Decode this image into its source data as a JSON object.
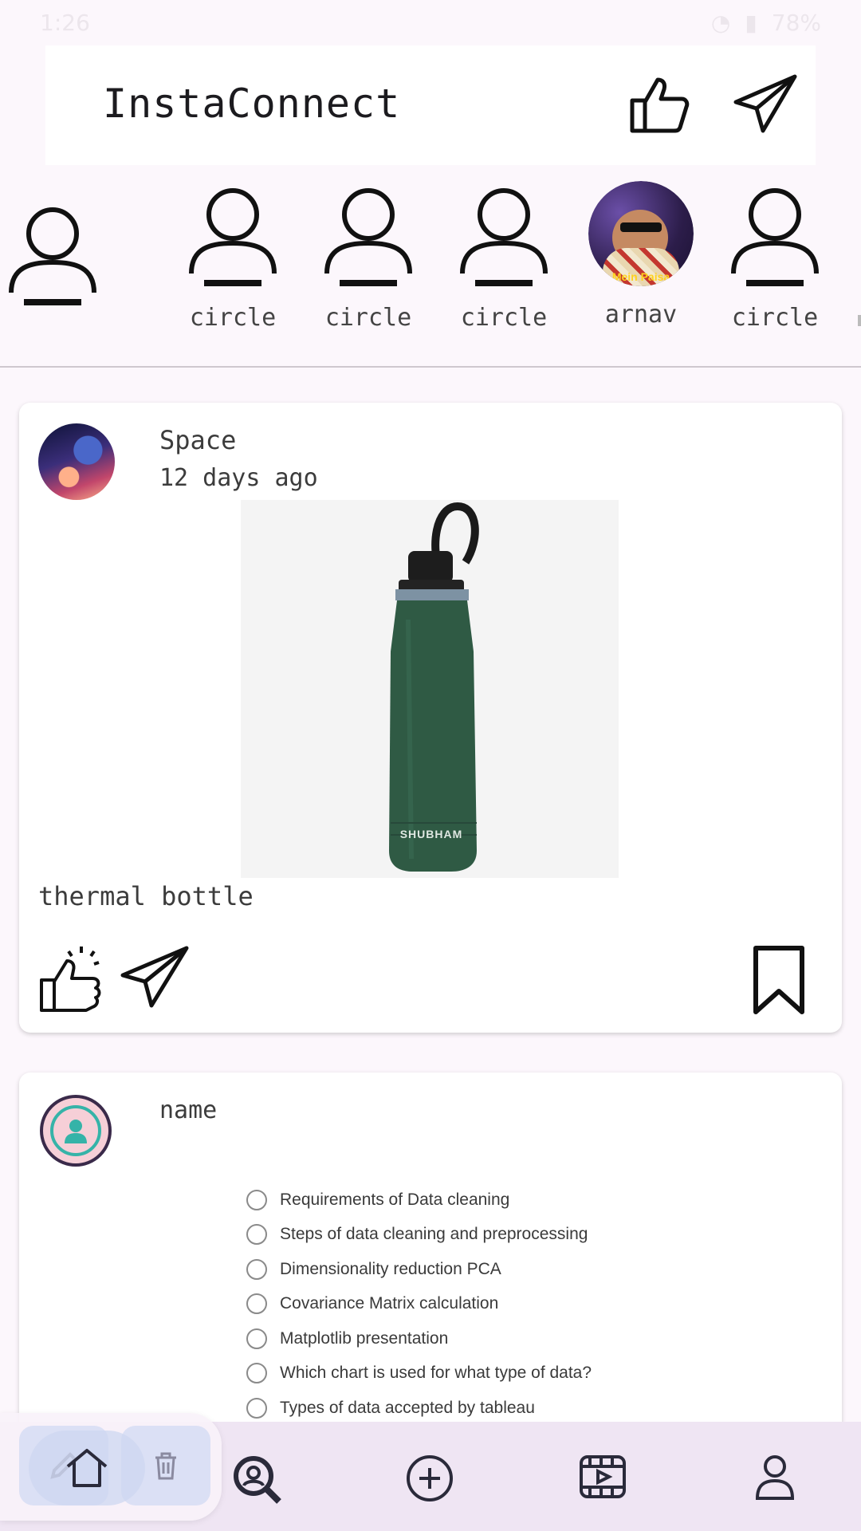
{
  "status_bar": {
    "time": "1:26",
    "battery": "78%"
  },
  "header": {
    "title": "InstaConnect",
    "like_icon": "thumbs-up-icon",
    "send_icon": "paper-plane-icon"
  },
  "stories": {
    "items": [
      {
        "label": "circle",
        "avatar": "person-outline"
      },
      {
        "label": "circle",
        "avatar": "person-outline"
      },
      {
        "label": "circle",
        "avatar": "person-outline"
      },
      {
        "label": "arnav",
        "avatar": "photo",
        "photo_caption": "Mein Paisa"
      },
      {
        "label": "circle",
        "avatar": "person-outline"
      }
    ]
  },
  "posts": [
    {
      "author": "Space",
      "time": "12 days ago",
      "image_text": "SHUBHAM",
      "caption": "thermal bottle",
      "actions": [
        "like-icon",
        "share-icon",
        "bookmark-icon"
      ]
    },
    {
      "author": "name",
      "checklist": [
        "Requirements of Data cleaning",
        "Steps of data cleaning and preprocessing",
        "Dimensionality reduction  PCA",
        "Covariance Matrix calculation",
        "Matplotlib presentation",
        "Which chart is used for what type of data?",
        "Types of data accepted by tableau"
      ]
    }
  ],
  "bottom_nav": {
    "items": [
      "home-icon",
      "search-icon",
      "add-icon",
      "reels-icon",
      "profile-icon"
    ]
  },
  "floating_toolbar": {
    "items": [
      "edit-icon",
      "delete-icon"
    ]
  },
  "colors": {
    "background": "#fcf7fc",
    "nav_background": "#efe5f3",
    "bottle_green": "#2f5a44"
  }
}
